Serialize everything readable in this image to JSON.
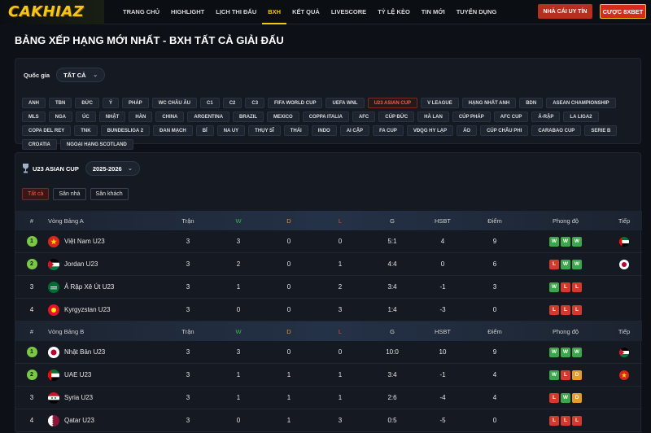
{
  "header": {
    "logo": "CAKHIAZ",
    "nav": [
      "TRANG CHỦ",
      "HIGHLIGHT",
      "LỊCH THI ĐẤU",
      "BXH",
      "KẾT QUẢ",
      "LIVESCORE",
      "TỶ LỆ KÈO",
      "TIN MỚI",
      "TUYỂN DỤNG"
    ],
    "active_nav": "BXH",
    "btn_trusted": "NHÀ CÁI UY TÍN",
    "btn_bet": "CƯỢC 8XBET"
  },
  "page_title": "BẢNG XẾP HẠNG MỚI NHẤT - BXH TẤT CẢ GIẢI ĐẤU",
  "filter": {
    "label": "Quốc gia",
    "selected": "TẤT CẢ",
    "chips": [
      "ANH",
      "TBN",
      "ĐỨC",
      "Ý",
      "PHÁP",
      "WC CHÂU ÂU",
      "C1",
      "C2",
      "C3",
      "FIFA WORLD CUP",
      "UEFA WNL",
      "U23 ASIAN CUP",
      "V LEAGUE",
      "HẠNG NHẤT ANH",
      "BDN",
      "ASEAN CHAMPIONSHIP",
      "MLS",
      "NGA",
      "ÚC",
      "NHẬT",
      "HÀN",
      "CHINA",
      "ARGENTINA",
      "BRAZIL",
      "MEXICO",
      "COPPA ITALIA",
      "AFC",
      "CÚP ĐỨC",
      "HÀ LAN",
      "CÚP PHÁP",
      "AFC CUP",
      "Ả-RẬP",
      "LA LIGA2",
      "COPA DEL REY",
      "TNK",
      "BUNDESLIGA 2",
      "ĐAN MẠCH",
      "BỈ",
      "NA UY",
      "THỤY SĨ",
      "THÁI",
      "INDO",
      "AI CẬP",
      "FA CUP",
      "VĐQG HY LẠP",
      "ÁO",
      "CÚP CHÂU PHI",
      "CARABAO CUP",
      "SERIE B",
      "CROATIA",
      "NGOẠI HẠNG SCOTLAND"
    ],
    "active_chip": "U23 ASIAN CUP"
  },
  "league": {
    "name": "U23 ASIAN CUP",
    "season": "2025-2026",
    "tabs": [
      "Tất cả",
      "Sân nhà",
      "Sân khách"
    ],
    "active_tab": "Tất cả"
  },
  "columns": {
    "rank": "#",
    "played": "Trận",
    "w": "W",
    "d": "D",
    "l": "L",
    "g": "G",
    "hsbt": "HSBT",
    "pts": "Điểm",
    "form": "Phong độ",
    "next": "Tiếp"
  },
  "groups": [
    {
      "name": "Vòng Bảng A",
      "rows": [
        {
          "rank": "1",
          "team": "Việt Nam U23",
          "played": "3",
          "w": "3",
          "d": "0",
          "l": "0",
          "g": "5:1",
          "hsbt": "4",
          "pts": "9",
          "form": [
            "W",
            "W",
            "W"
          ],
          "next_flag": "uae-flag-icon"
        },
        {
          "rank": "2",
          "team": "Jordan U23",
          "played": "3",
          "w": "2",
          "d": "0",
          "l": "1",
          "g": "4:4",
          "hsbt": "0",
          "pts": "6",
          "form": [
            "L",
            "W",
            "W"
          ],
          "next_flag": "japan-flag-icon"
        },
        {
          "rank": "3",
          "team": "Ả Rập Xê Út U23",
          "played": "3",
          "w": "1",
          "d": "0",
          "l": "2",
          "g": "3:4",
          "hsbt": "-1",
          "pts": "3",
          "form": [
            "W",
            "L",
            "L"
          ],
          "next_flag": ""
        },
        {
          "rank": "4",
          "team": "Kyrgyzstan U23",
          "played": "3",
          "w": "0",
          "d": "0",
          "l": "3",
          "g": "1:4",
          "hsbt": "-3",
          "pts": "0",
          "form": [
            "L",
            "L",
            "L"
          ],
          "next_flag": ""
        }
      ]
    },
    {
      "name": "Vòng Bảng B",
      "rows": [
        {
          "rank": "1",
          "team": "Nhật Bản U23",
          "played": "3",
          "w": "3",
          "d": "0",
          "l": "0",
          "g": "10:0",
          "hsbt": "10",
          "pts": "9",
          "form": [
            "W",
            "W",
            "W"
          ],
          "next_flag": "jordan-flag-icon"
        },
        {
          "rank": "2",
          "team": "UAE U23",
          "played": "3",
          "w": "1",
          "d": "1",
          "l": "1",
          "g": "3:4",
          "hsbt": "-1",
          "pts": "4",
          "form": [
            "W",
            "L",
            "D"
          ],
          "next_flag": "vietnam-flag-icon"
        },
        {
          "rank": "3",
          "team": "Syria U23",
          "played": "3",
          "w": "1",
          "d": "1",
          "l": "1",
          "g": "2:6",
          "hsbt": "-4",
          "pts": "4",
          "form": [
            "L",
            "W",
            "D"
          ],
          "next_flag": ""
        },
        {
          "rank": "4",
          "team": "Qatar U23",
          "played": "3",
          "w": "0",
          "d": "1",
          "l": "3",
          "g": "0:5",
          "hsbt": "-5",
          "pts": "0",
          "form": [
            "L",
            "L",
            "L"
          ],
          "next_flag": ""
        }
      ]
    }
  ]
}
